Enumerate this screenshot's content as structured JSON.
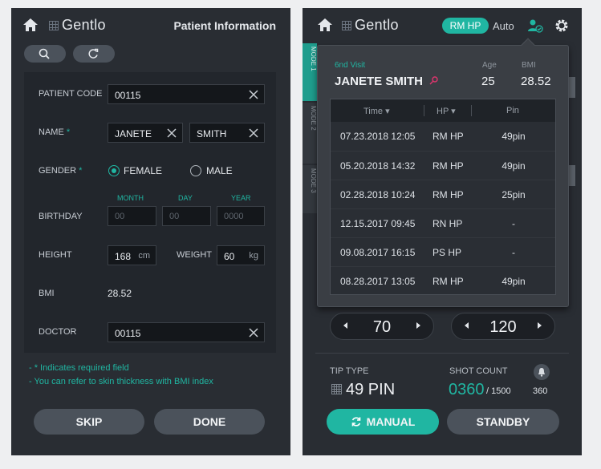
{
  "left": {
    "logo": "Gentlo",
    "title": "Patient Information",
    "form": {
      "patient_code_label": "PATIENT CODE",
      "patient_code": "00115",
      "name_label": "NAME",
      "required_mark": "*",
      "first_name": "JANETE",
      "last_name": "SMITH",
      "gender_label": "GENDER",
      "gender_female": "FEMALE",
      "gender_male": "MALE",
      "gender_selected": "FEMALE",
      "birthday_label": "BIRTHDAY",
      "month_label": "MONTH",
      "day_label": "DAY",
      "year_label": "YEAR",
      "month_placeholder": "00",
      "day_placeholder": "00",
      "year_placeholder": "0000",
      "height_label": "HEIGHT",
      "height_value": "168",
      "height_unit": "cm",
      "weight_label": "WEIGHT",
      "weight_value": "60",
      "weight_unit": "kg",
      "bmi_label": "BMI",
      "bmi_value": "28.52",
      "doctor_label": "DOCTOR",
      "doctor_value": "00115"
    },
    "notes": [
      "- * Indicates required field",
      "- You can refer to skin thickness with BMI index"
    ],
    "skip_label": "SKIP",
    "done_label": "DONE"
  },
  "right": {
    "logo": "Gentlo",
    "mode_badge": "RM HP",
    "auto_label": "Auto",
    "side_tabs": [
      "MODE 1",
      "MODE 2",
      "MODE 3"
    ],
    "popup": {
      "visit": "6nd Visit",
      "patient_name": "JANETE SMITH",
      "age_label": "Age",
      "age_value": "25",
      "bmi_label": "BMI",
      "bmi_value": "28.52",
      "columns": [
        "Time",
        "HP",
        "Pin"
      ],
      "rows": [
        {
          "time": "07.23.2018  12:05",
          "hp": "RM HP",
          "pin": "49pin"
        },
        {
          "time": "05.20.2018  14:32",
          "hp": "RM HP",
          "pin": "49pin"
        },
        {
          "time": "02.28.2018  10:24",
          "hp": "RM HP",
          "pin": "25pin"
        },
        {
          "time": "12.15.2017  09:45",
          "hp": "RN HP",
          "pin": "-"
        },
        {
          "time": "09.08.2017  16:15",
          "hp": "PS HP",
          "pin": "-"
        },
        {
          "time": "08.28.2017  13:05",
          "hp": "RM HP",
          "pin": "49pin"
        }
      ]
    },
    "stepper_left": "70",
    "stepper_right": "120",
    "tip_type_label": "TIP TYPE",
    "tip_type_value": "49 PIN",
    "shot_count_label": "SHOT COUNT",
    "shot_count_current": "0360",
    "shot_count_total": "/ 1500",
    "shot_count_extra": "360",
    "manual_label": "MANUAL",
    "standby_label": "STANDBY",
    "accent_color": "#20b6a2"
  }
}
